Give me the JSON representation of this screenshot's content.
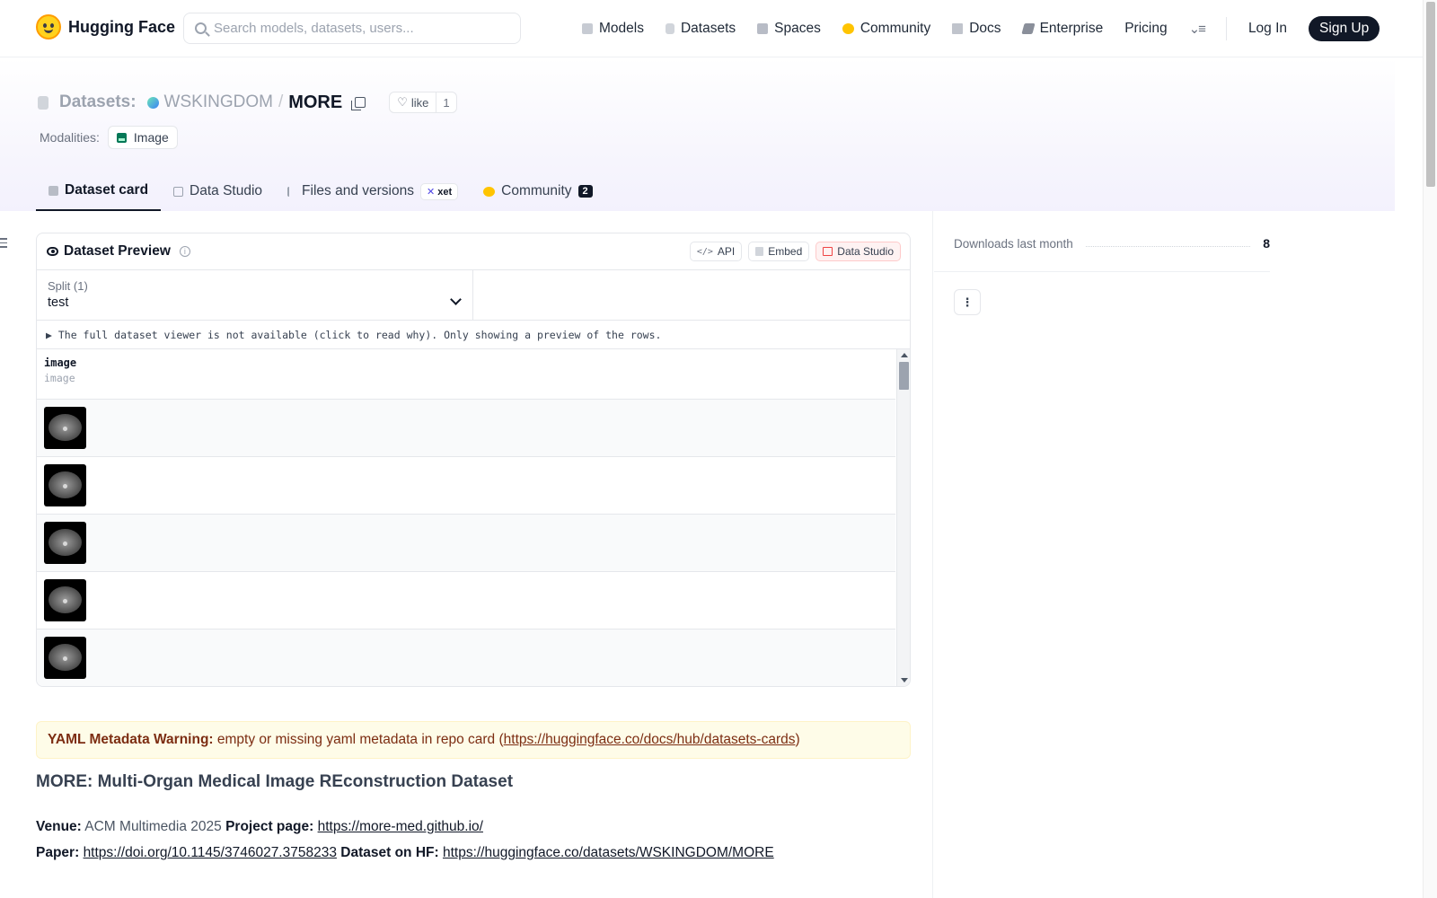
{
  "brand": {
    "name": "Hugging Face",
    "logo_icon": "hugging-face-logo-icon"
  },
  "search": {
    "placeholder": "Search models, datasets, users..."
  },
  "nav": {
    "items": [
      {
        "label": "Models",
        "icon": "cube-icon"
      },
      {
        "label": "Datasets",
        "icon": "database-icon"
      },
      {
        "label": "Spaces",
        "icon": "grid-icon"
      },
      {
        "label": "Community",
        "icon": "community-icon"
      },
      {
        "label": "Docs",
        "icon": "book-icon"
      },
      {
        "label": "Enterprise",
        "icon": "enterprise-icon"
      },
      {
        "label": "Pricing",
        "icon": ""
      }
    ],
    "login": "Log In",
    "signup": "Sign Up"
  },
  "repo": {
    "section": "Datasets:",
    "org": "WSKINGDOM",
    "separator": "/",
    "name": "MORE",
    "like_label": "like",
    "like_count": "1",
    "modalities_label": "Modalities:",
    "modalities": [
      "Image"
    ]
  },
  "tabs": [
    {
      "label": "Dataset card",
      "active": true
    },
    {
      "label": "Data Studio",
      "active": false
    },
    {
      "label": "Files and versions",
      "active": false,
      "badge": "xet"
    },
    {
      "label": "Community",
      "active": false,
      "count": "2"
    }
  ],
  "viewer": {
    "title": "Dataset Preview",
    "buttons": {
      "api": "API",
      "embed": "Embed",
      "studio": "Data Studio"
    },
    "split_label": "Split (1)",
    "split_value": "test",
    "notice": "▶ The full dataset viewer is not available (click to read why). Only showing a preview of the rows.",
    "column": {
      "name": "image",
      "type": "image"
    },
    "rows": 5
  },
  "card": {
    "warning_title": "YAML Metadata Warning:",
    "warning_text": " empty or missing yaml metadata in repo card (",
    "warning_link": "https://huggingface.co/docs/hub/datasets-cards",
    "warning_close": ")",
    "heading": "MORE: Multi-Organ Medical Image REconstruction Dataset",
    "venue_label": "Venue:",
    "venue": " ACM Multimedia 2025 ",
    "project_label": "Project page:",
    "project_url": "https://more-med.github.io/",
    "paper_label": "Paper:",
    "paper_url": "https://doi.org/10.1145/3746027.3758233",
    "hf_label": "Dataset on HF:",
    "hf_url": "https://huggingface.co/datasets/WSKINGDOM/MORE"
  },
  "sidebar": {
    "downloads_label": "Downloads last month",
    "downloads_value": "8",
    "more_icon": "kebab-icon"
  },
  "colors": {
    "accent": "#111827",
    "warning_bg": "#fefce8",
    "warning_text": "#7c2d12"
  }
}
